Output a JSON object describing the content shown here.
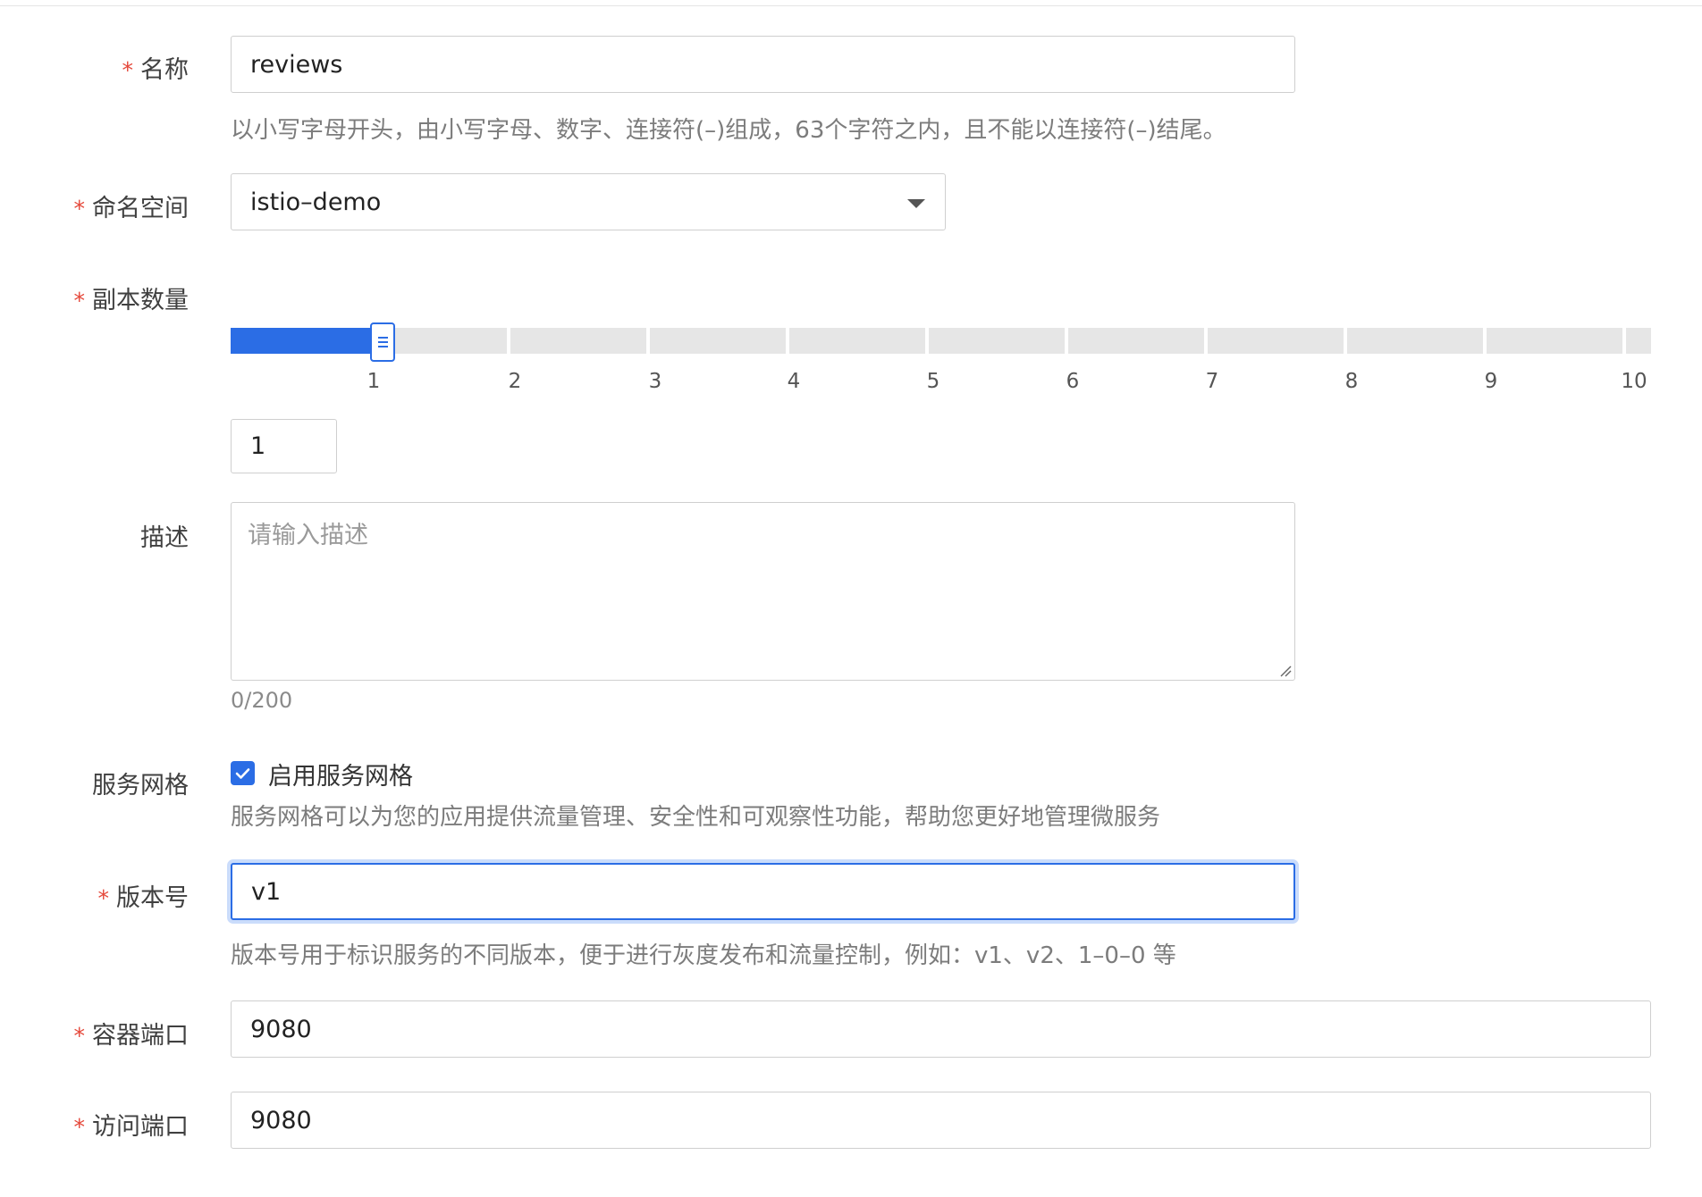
{
  "form": {
    "name": {
      "label": "名称",
      "required_mark": "*",
      "value": "reviews",
      "hint": "以小写字母开头，由小写字母、数字、连接符(–)组成，63个字符之内，且不能以连接符(–)结尾。"
    },
    "namespace": {
      "label": "命名空间",
      "required_mark": "*",
      "selected": "istio–demo"
    },
    "replicas": {
      "label": "副本数量",
      "required_mark": "*",
      "slider_min": 1,
      "slider_max": 10,
      "slider_value": 1,
      "ticks": [
        "1",
        "2",
        "3",
        "4",
        "5",
        "6",
        "7",
        "8",
        "9",
        "10"
      ],
      "input_value": "1"
    },
    "description": {
      "label": "描述",
      "placeholder": "请输入描述",
      "counter": "0/200"
    },
    "mesh": {
      "label": "服务网格",
      "checkbox_label": "启用服务网格",
      "checked": true,
      "hint": "服务网格可以为您的应用提供流量管理、安全性和可观察性功能，帮助您更好地管理微服务"
    },
    "version": {
      "label": "版本号",
      "required_mark": "*",
      "value": "v1",
      "hint": "版本号用于标识服务的不同版本，便于进行灰度发布和流量控制，例如：v1、v2、1–0–0 等"
    },
    "container_port": {
      "label": "容器端口",
      "required_mark": "*",
      "value": "9080"
    },
    "access_port": {
      "label": "访问端口",
      "required_mark": "*",
      "value": "9080"
    }
  },
  "colors": {
    "accent": "#2b6de5",
    "required": "#e5483a",
    "hint_text": "#7c7c7c",
    "border": "#cfcfcf"
  }
}
